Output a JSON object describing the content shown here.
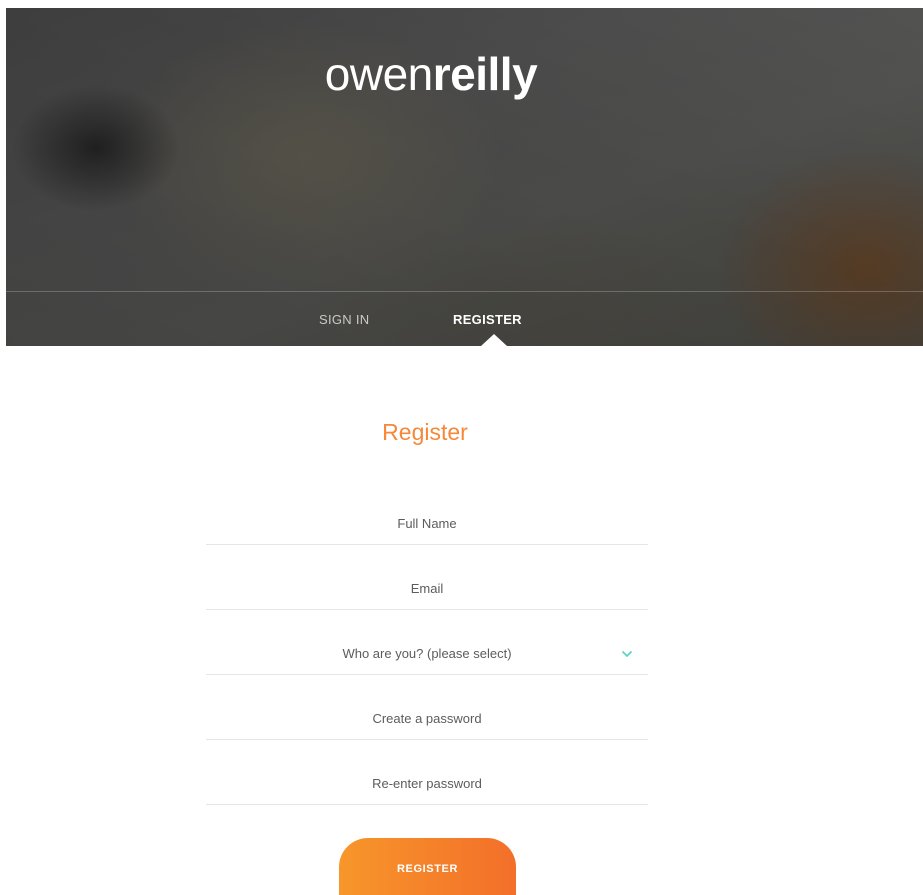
{
  "header": {
    "logo_light": "owen",
    "logo_bold": "reilly"
  },
  "tabs": {
    "sign_in": "SIGN IN",
    "register": "REGISTER",
    "active": "register"
  },
  "form": {
    "title": "Register",
    "full_name_placeholder": "Full Name",
    "email_placeholder": "Email",
    "role_select_value": "Who are you? (please select)",
    "password_placeholder": "Create a password",
    "reenter_password_placeholder": "Re-enter password",
    "submit_label": "REGISTER"
  },
  "icons": {
    "role_dropdown": "chevron-down-icon"
  },
  "colors": {
    "accent_orange": "#f6883a",
    "button_gradient_start": "#f7962a",
    "button_gradient_end": "#f36f2a",
    "chevron_teal": "#5fd3c8"
  }
}
